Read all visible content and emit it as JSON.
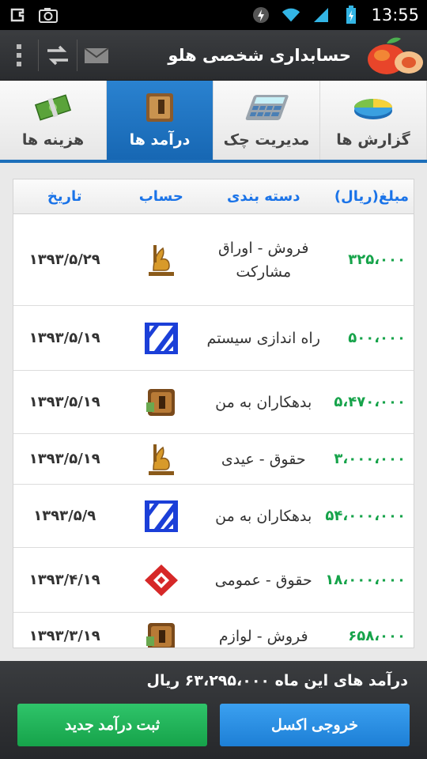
{
  "status_bar": {
    "time": "13:55"
  },
  "action_bar": {
    "title": "حسابداری شخصی هلو"
  },
  "tabs": [
    {
      "label": "هزینه ها",
      "icon": "money-icon",
      "active": false
    },
    {
      "label": "درآمد ها",
      "icon": "wallet-icon",
      "active": true
    },
    {
      "label": "مدیریت چک",
      "icon": "calculator-icon",
      "active": false
    },
    {
      "label": "گزارش ها",
      "icon": "pie-chart-icon",
      "active": false
    }
  ],
  "table": {
    "headers": {
      "date": "تاریخ",
      "account": "حساب",
      "category": "دسته بندی",
      "amount": "مبلغ(ریال)"
    },
    "rows": [
      {
        "date": "۱۳۹۳/۵/۲۹",
        "account_icon": "bank-persepolis-icon",
        "category": "فروش - اوراق مشارکت",
        "amount": "۳۲۵،۰۰۰"
      },
      {
        "date": "۱۳۹۳/۵/۱۹",
        "account_icon": "bank-tejarat-icon",
        "category": "راه اندازی سیستم",
        "amount": "۵۰۰،۰۰۰"
      },
      {
        "date": "۱۳۹۳/۵/۱۹",
        "account_icon": "wallet-icon",
        "category": "بدهکاران به من",
        "amount": "۵،۴۷۰،۰۰۰"
      },
      {
        "date": "۱۳۹۳/۵/۱۹",
        "account_icon": "bank-persepolis-icon",
        "category": "حقوق - عیدی",
        "amount": "۳،۰۰۰،۰۰۰"
      },
      {
        "date": "۱۳۹۳/۵/۹",
        "account_icon": "bank-tejarat-icon",
        "category": "بدهکاران به من",
        "amount": "۵۴،۰۰۰،۰۰۰"
      },
      {
        "date": "۱۳۹۳/۴/۱۹",
        "account_icon": "bank-mellat-icon",
        "category": "حقوق - عمومی",
        "amount": "۱۸،۰۰۰،۰۰۰"
      },
      {
        "date": "۱۳۹۳/۳/۱۹",
        "account_icon": "wallet-icon",
        "category": "فروش - لوازم",
        "amount": "۶۵۸،۰۰۰"
      }
    ]
  },
  "footer": {
    "summary": "درآمد های این ماه  ۶۳،۲۹۵،۰۰۰ ریال",
    "new_income_label": "ثبت درآمد جدید",
    "excel_label": "خروجی اکسل"
  },
  "colors": {
    "accent": "#1d6fba",
    "amount": "#16a34a",
    "header_text": "#1a73e8"
  }
}
